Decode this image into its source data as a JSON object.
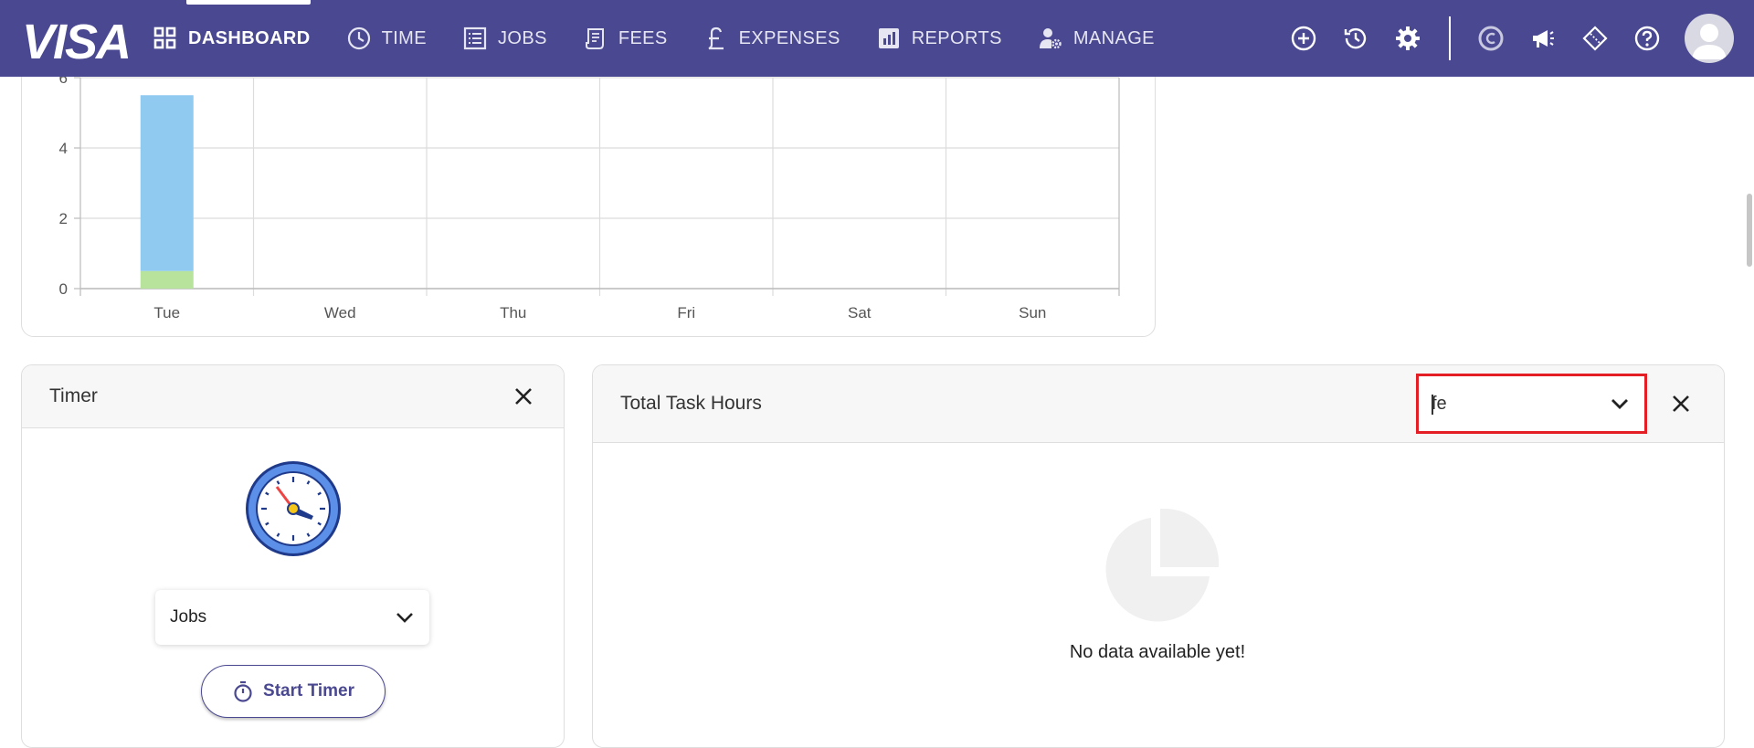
{
  "nav": {
    "brand": "VISA",
    "items": [
      {
        "label": "DASHBOARD",
        "icon": "grid-icon",
        "active": true
      },
      {
        "label": "TIME",
        "icon": "clock-icon"
      },
      {
        "label": "JOBS",
        "icon": "list-icon"
      },
      {
        "label": "FEES",
        "icon": "receipt-icon"
      },
      {
        "label": "EXPENSES",
        "icon": "pound-icon"
      },
      {
        "label": "REPORTS",
        "icon": "bar-chart-icon"
      },
      {
        "label": "MANAGE",
        "icon": "user-gear-icon"
      }
    ],
    "tools": [
      "plus-circle-icon",
      "history-icon",
      "gear-icon",
      "c-logo-icon",
      "megaphone-icon",
      "ticket-icon",
      "help-icon"
    ]
  },
  "colors": {
    "nav_bg": "#4a4891",
    "bar_blue": "#90caf0",
    "bar_green": "#b7e39d",
    "highlight": "#e31e24"
  },
  "chart_data": {
    "type": "bar",
    "stacked": true,
    "categories": [
      "Tue",
      "Wed",
      "Thu",
      "Fri",
      "Sat",
      "Sun"
    ],
    "series": [
      {
        "values": [
          0.5,
          0,
          0,
          0,
          0,
          0
        ],
        "color": "#b7e39d"
      },
      {
        "values": [
          5,
          0,
          0,
          0,
          0,
          0
        ],
        "color": "#90caf0"
      }
    ],
    "yticks": [
      "0",
      "2",
      "4",
      "6"
    ],
    "ylim": [
      0,
      6
    ],
    "grid": true
  },
  "timer": {
    "title": "Timer",
    "select_value": "Jobs",
    "start_label": "Start Timer"
  },
  "hours": {
    "title": "Total Task Hours",
    "select_value": "fe",
    "empty_text": "No data available yet!"
  }
}
